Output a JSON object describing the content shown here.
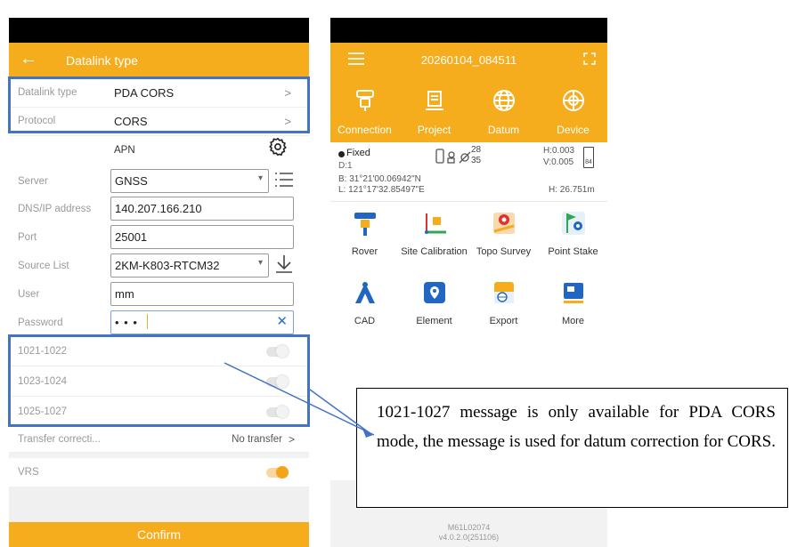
{
  "left": {
    "title": "Datalink type",
    "rows": [
      {
        "label": "Datalink type",
        "value": "PDA CORS"
      },
      {
        "label": "Protocol",
        "value": "CORS"
      }
    ],
    "apn_label": "APN",
    "server": {
      "label": "Server",
      "value": "GNSS"
    },
    "ip": {
      "label": "DNS/IP address",
      "value": "140.207.166.210"
    },
    "port": {
      "label": "Port",
      "value": "25001"
    },
    "source": {
      "label": "Source List",
      "value": "2KM-K803-RTCM32"
    },
    "user": {
      "label": "User",
      "value": "mm"
    },
    "password": {
      "label": "Password",
      "value": "• • •"
    },
    "messages": [
      {
        "label": "1021-1022",
        "on": false
      },
      {
        "label": "1023-1024",
        "on": false
      },
      {
        "label": "1025-1027",
        "on": false
      }
    ],
    "transfer": {
      "label": "Transfer correcti...",
      "value": "No transfer"
    },
    "vrs": {
      "label": "VRS",
      "on": true
    },
    "confirm": "Confirm"
  },
  "right": {
    "project_name": "20260104_084511",
    "tabs": [
      "Connection",
      "Project",
      "Datum",
      "Device"
    ],
    "status": {
      "fix": "Fixed",
      "diff": "D:1",
      "sats_used": "28",
      "sats_total": "35",
      "h_prec": "H:0.003",
      "v_prec": "V:0.005",
      "battery": "84",
      "lat": "B: 31°21'00.06942\"N",
      "lon": "L: 121°17'32.85497\"E",
      "height": "H: 26.751m"
    },
    "apps": [
      {
        "label": "Rover",
        "icon": "rover-icon"
      },
      {
        "label": "Site Calibration",
        "icon": "site-calibration-icon"
      },
      {
        "label": "Topo Survey",
        "icon": "topo-survey-icon"
      },
      {
        "label": "Point Stake",
        "icon": "point-stake-icon"
      },
      {
        "label": "CAD",
        "icon": "cad-icon"
      },
      {
        "label": "Element",
        "icon": "element-icon"
      },
      {
        "label": "Export",
        "icon": "export-icon"
      },
      {
        "label": "More",
        "icon": "more-icon"
      }
    ],
    "footer_line1": "M61L02074",
    "footer_line2": "v4.0.2.0(251106)"
  },
  "callout": "1021-1027 message is only available for PDA CORS mode, the message is used for datum correction for CORS.",
  "colors": {
    "accent": "#f5ad1d",
    "highlight": "#4472c4",
    "icon_blue": "#2166c2"
  }
}
